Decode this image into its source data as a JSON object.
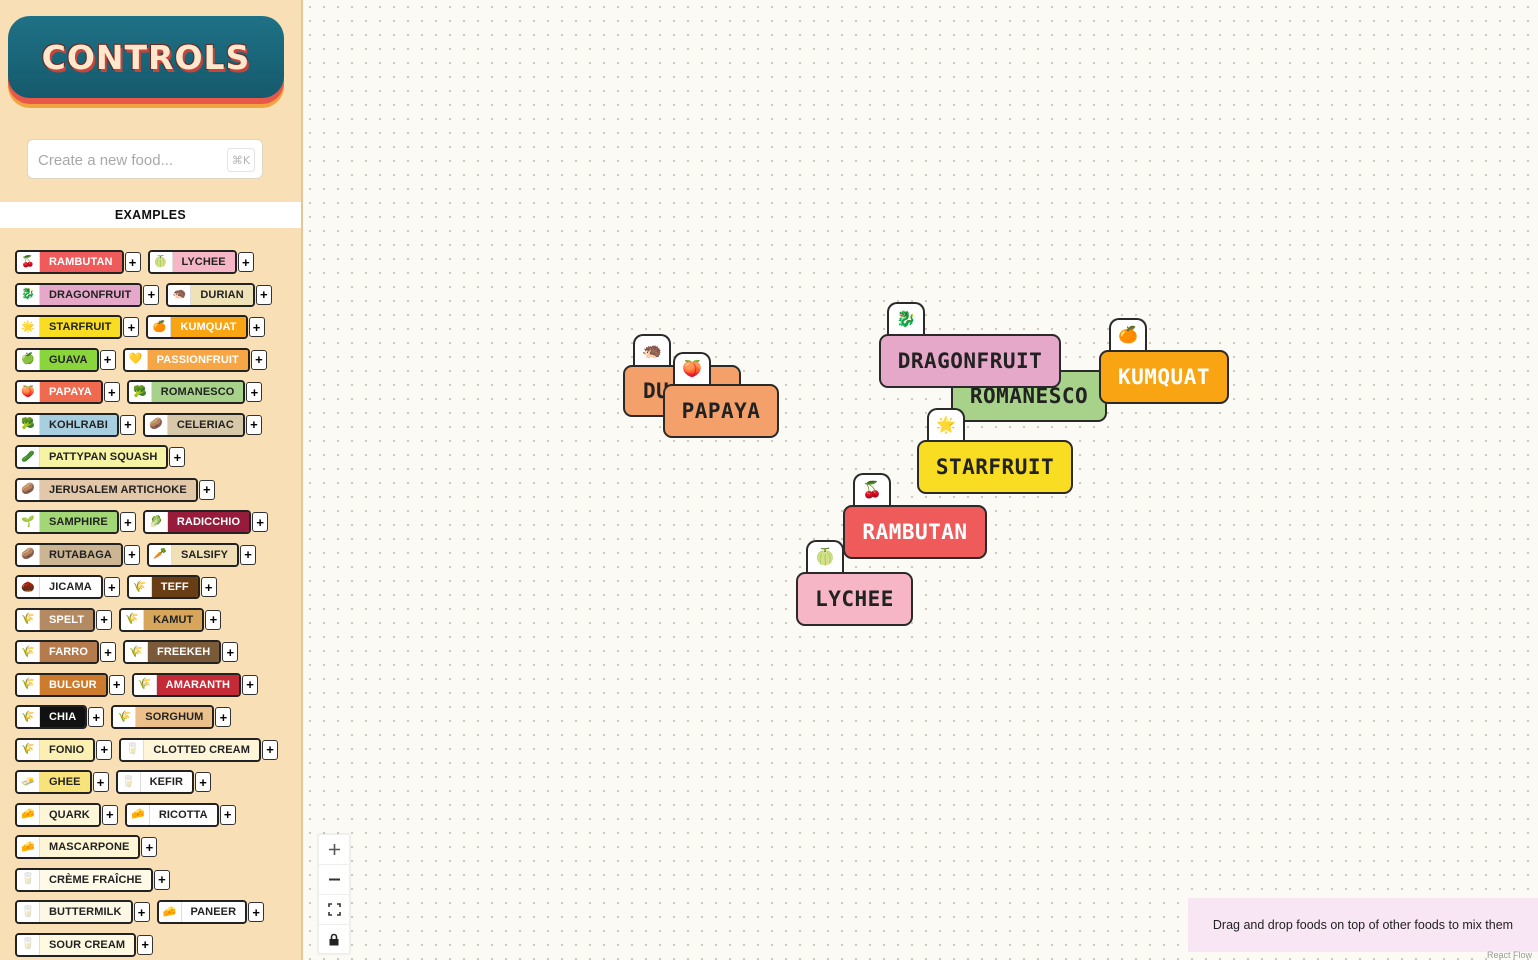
{
  "sidebar": {
    "logo_text": "CONTROLS",
    "search": {
      "placeholder": "Create a new food...",
      "shortcut": "⌘K"
    },
    "examples_title": "EXAMPLES",
    "add_label": "+",
    "items": [
      {
        "label": "RAMBUTAN",
        "icon": "🍒",
        "bg": "#ef5a5a",
        "fg": "#ffffff"
      },
      {
        "label": "LYCHEE",
        "icon": "🍈",
        "bg": "#f7b6c6",
        "fg": "#222222"
      },
      {
        "label": "DRAGONFRUIT",
        "icon": "🐉",
        "bg": "#e6a8c8",
        "fg": "#222222"
      },
      {
        "label": "DURIAN",
        "icon": "🦔",
        "bg": "#eee2b6",
        "fg": "#222222"
      },
      {
        "label": "STARFRUIT",
        "icon": "🌟",
        "bg": "#f8dd22",
        "fg": "#222222"
      },
      {
        "label": "KUMQUAT",
        "icon": "🍊",
        "bg": "#f9a412",
        "fg": "#ffffff"
      },
      {
        "label": "GUAVA",
        "icon": "🍏",
        "bg": "#8ad43c",
        "fg": "#222222"
      },
      {
        "label": "PASSIONFRUIT",
        "icon": "💛",
        "bg": "#f7a645",
        "fg": "#ffffff"
      },
      {
        "label": "PAPAYA",
        "icon": "🍑",
        "bg": "#ef6a4f",
        "fg": "#ffffff"
      },
      {
        "label": "ROMANESCO",
        "icon": "🥦",
        "bg": "#a8d28a",
        "fg": "#222222"
      },
      {
        "label": "KOHLRABI",
        "icon": "🥦",
        "bg": "#a8cfe0",
        "fg": "#222222"
      },
      {
        "label": "CELERIAC",
        "icon": "🥔",
        "bg": "#d8c8aa",
        "fg": "#222222"
      },
      {
        "label": "PATTYPAN SQUASH",
        "icon": "🥒",
        "bg": "#f6f3a4",
        "fg": "#222222"
      },
      {
        "label": "JERUSALEM ARTICHOKE",
        "icon": "🥔",
        "bg": "#e2c7a8",
        "fg": "#222222"
      },
      {
        "label": "SAMPHIRE",
        "icon": "🌱",
        "bg": "#a3d776",
        "fg": "#222222"
      },
      {
        "label": "RADICCHIO",
        "icon": "🥬",
        "bg": "#971c3c",
        "fg": "#ffffff"
      },
      {
        "label": "RUTABAGA",
        "icon": "🥔",
        "bg": "#cbb592",
        "fg": "#222222"
      },
      {
        "label": "SALSIFY",
        "icon": "🥕",
        "bg": "#f1e0b6",
        "fg": "#222222"
      },
      {
        "label": "JICAMA",
        "icon": "🌰",
        "bg": "#ffffff",
        "fg": "#222222"
      },
      {
        "label": "TEFF",
        "icon": "🌾",
        "bg": "#6a3e14",
        "fg": "#ffffff"
      },
      {
        "label": "SPELT",
        "icon": "🌾",
        "bg": "#b48a62",
        "fg": "#ffffff"
      },
      {
        "label": "KAMUT",
        "icon": "🌾",
        "bg": "#d8a65a",
        "fg": "#222222"
      },
      {
        "label": "FARRO",
        "icon": "🌾",
        "bg": "#b57b4c",
        "fg": "#ffffff"
      },
      {
        "label": "FREEKEH",
        "icon": "🌾",
        "bg": "#7b5a3a",
        "fg": "#ffffff"
      },
      {
        "label": "BULGUR",
        "icon": "🌾",
        "bg": "#cd7c2e",
        "fg": "#ffffff"
      },
      {
        "label": "AMARANTH",
        "icon": "🌾",
        "bg": "#c42b37",
        "fg": "#ffffff"
      },
      {
        "label": "CHIA",
        "icon": "🌾",
        "bg": "#111111",
        "fg": "#ffffff"
      },
      {
        "label": "SORGHUM",
        "icon": "🌾",
        "bg": "#ecc08a",
        "fg": "#222222"
      },
      {
        "label": "FONIO",
        "icon": "🌾",
        "bg": "#fbf0b2",
        "fg": "#222222"
      },
      {
        "label": "CLOTTED CREAM",
        "icon": "🥛",
        "bg": "#fff5d8",
        "fg": "#222222"
      },
      {
        "label": "GHEE",
        "icon": "🧈",
        "bg": "#f8e27a",
        "fg": "#222222"
      },
      {
        "label": "KEFIR",
        "icon": "🥛",
        "bg": "#ffffff",
        "fg": "#222222"
      },
      {
        "label": "QUARK",
        "icon": "🧀",
        "bg": "#fdf6d8",
        "fg": "#222222"
      },
      {
        "label": "RICOTTA",
        "icon": "🧀",
        "bg": "#ffffff",
        "fg": "#222222"
      },
      {
        "label": "MASCARPONE",
        "icon": "🧀",
        "bg": "#fff6d6",
        "fg": "#222222"
      },
      {
        "label": "CRÈME FRAÎCHE",
        "icon": "🥛",
        "bg": "#fff9e8",
        "fg": "#222222"
      },
      {
        "label": "BUTTERMILK",
        "icon": "🥛",
        "bg": "#fdf7e6",
        "fg": "#222222"
      },
      {
        "label": "PANEER",
        "icon": "🧀",
        "bg": "#ffffff",
        "fg": "#222222"
      },
      {
        "label": "SOUR CREAM",
        "icon": "🥛",
        "bg": "#fff9e2",
        "fg": "#222222"
      }
    ]
  },
  "canvas": {
    "nodes": [
      {
        "label": "DURIAN",
        "visible_label": "DU",
        "icon": "🦔",
        "bg": "#f4a06b",
        "fg": "#222222"
      },
      {
        "label": "PAPAYA",
        "icon": "🍑",
        "bg": "#f4a06b",
        "fg": "#222222"
      },
      {
        "label": "ROMANESCO",
        "icon": "🥦",
        "bg": "#a8d28a",
        "fg": "#222222"
      },
      {
        "label": "DRAGONFRUIT",
        "icon": "🐉",
        "bg": "#e6a8c8",
        "fg": "#222222"
      },
      {
        "label": "KUMQUAT",
        "icon": "🍊",
        "bg": "#f9a412",
        "fg": "#ffffff"
      },
      {
        "label": "STARFRUIT",
        "icon": "🌟",
        "bg": "#f8dd22",
        "fg": "#222222"
      },
      {
        "label": "RAMBUTAN",
        "icon": "🍒",
        "bg": "#ef5a5a",
        "fg": "#ffffff"
      },
      {
        "label": "LYCHEE",
        "icon": "🍈",
        "bg": "#f7b6c6",
        "fg": "#222222"
      }
    ],
    "controls": {
      "zoom_in_icon": "plus-icon",
      "zoom_out_icon": "minus-icon",
      "fit_view_icon": "fit-view-icon",
      "lock_icon": "lock-icon"
    },
    "hint": "Drag and drop foods on top of other foods to mix them",
    "attribution": "React Flow"
  }
}
